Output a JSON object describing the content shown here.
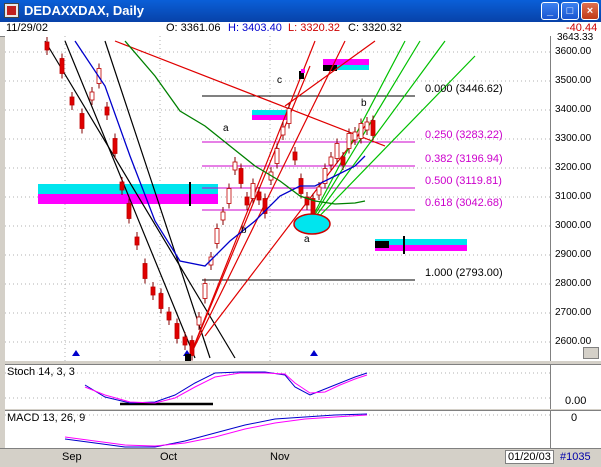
{
  "window": {
    "title": "DEDAXXDAX, Daily"
  },
  "infobar": {
    "date": "11/29/02",
    "open": "O: 3361.06",
    "high": "H: 3403.40",
    "low": "L: 3320.32",
    "close": "C: 3320.32",
    "change": "-40.44"
  },
  "yaxis": {
    "ticks": [
      "3600.00",
      "3500.00",
      "3400.00",
      "3300.00",
      "3200.00",
      "3100.00",
      "3000.00",
      "2900.00",
      "2800.00",
      "2700.00",
      "2600.00"
    ],
    "top_partial": "3643.33"
  },
  "fib_levels": [
    {
      "label": "0.000 (3446.62)",
      "color": "#000000"
    },
    {
      "label": "0.250 (3283.22)",
      "color": "#cc00cc"
    },
    {
      "label": "0.382 (3196.94)",
      "color": "#cc00cc"
    },
    {
      "label": "0.500 (3119.81)",
      "color": "#cc00cc"
    },
    {
      "label": "0.618 (3042.68)",
      "color": "#cc00cc"
    },
    {
      "label": "1.000 (2793.00)",
      "color": "#000000"
    }
  ],
  "wave_labels": {
    "a1": "a",
    "b1": "b",
    "c": "c",
    "a2": "a",
    "b2": "b"
  },
  "stoch": {
    "label": "Stoch 14, 3, 3",
    "value": "0.00"
  },
  "macd": {
    "label": "MACD 13, 26, 9",
    "value": "0"
  },
  "xaxis": {
    "months": [
      "Sep",
      "Oct",
      "Nov"
    ],
    "date_box": "01/20/03",
    "bar_count": "#1035"
  },
  "colors": {
    "accent": "#0a5fd8",
    "magenta": "#ff00ff",
    "cyan": "#00e5ee",
    "red_candle": "#e00000"
  }
}
